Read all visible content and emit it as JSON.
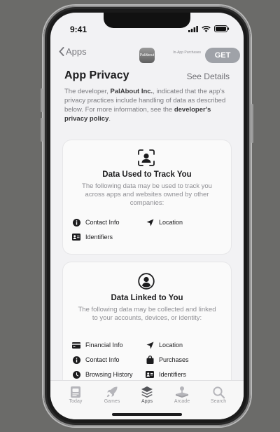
{
  "status": {
    "time": "9:41"
  },
  "nav": {
    "back_label": "Apps",
    "app_icon_text": "PalAbout",
    "iap_note": "In-App Purchases",
    "get_label": "GET"
  },
  "privacy": {
    "title": "App Privacy",
    "see_details": "See Details",
    "desc_prefix": "The developer, ",
    "developer": "PalAbout Inc.",
    "desc_middle": ", indicated that the app's privacy practices include handling of data as described below. For more information, see the ",
    "policy_link": "developer's privacy policy",
    "desc_suffix": "."
  },
  "cards": [
    {
      "title": "Data Used to Track You",
      "description": "The following data may be used to track you across apps and websites owned by other companies:",
      "items": [
        {
          "label": "Contact Info",
          "icon": "info-icon"
        },
        {
          "label": "Location",
          "icon": "location-arrow-icon"
        },
        {
          "label": "Identifiers",
          "icon": "id-card-icon"
        }
      ]
    },
    {
      "title": "Data Linked to You",
      "description": "The following data may be collected and linked to your accounts, devices, or identity:",
      "items": [
        {
          "label": "Financial Info",
          "icon": "credit-card-icon"
        },
        {
          "label": "Location",
          "icon": "location-arrow-icon"
        },
        {
          "label": "Contact Info",
          "icon": "info-icon"
        },
        {
          "label": "Purchases",
          "icon": "shopping-bag-icon"
        },
        {
          "label": "Browsing History",
          "icon": "clock-icon"
        },
        {
          "label": "Identifiers",
          "icon": "id-card-icon"
        }
      ]
    }
  ],
  "tabs": [
    {
      "label": "Today",
      "icon": "today-icon",
      "active": false
    },
    {
      "label": "Games",
      "icon": "rocket-icon",
      "active": false
    },
    {
      "label": "Apps",
      "icon": "layers-icon",
      "active": true
    },
    {
      "label": "Arcade",
      "icon": "joystick-icon",
      "active": false
    },
    {
      "label": "Search",
      "icon": "search-icon",
      "active": false
    }
  ]
}
